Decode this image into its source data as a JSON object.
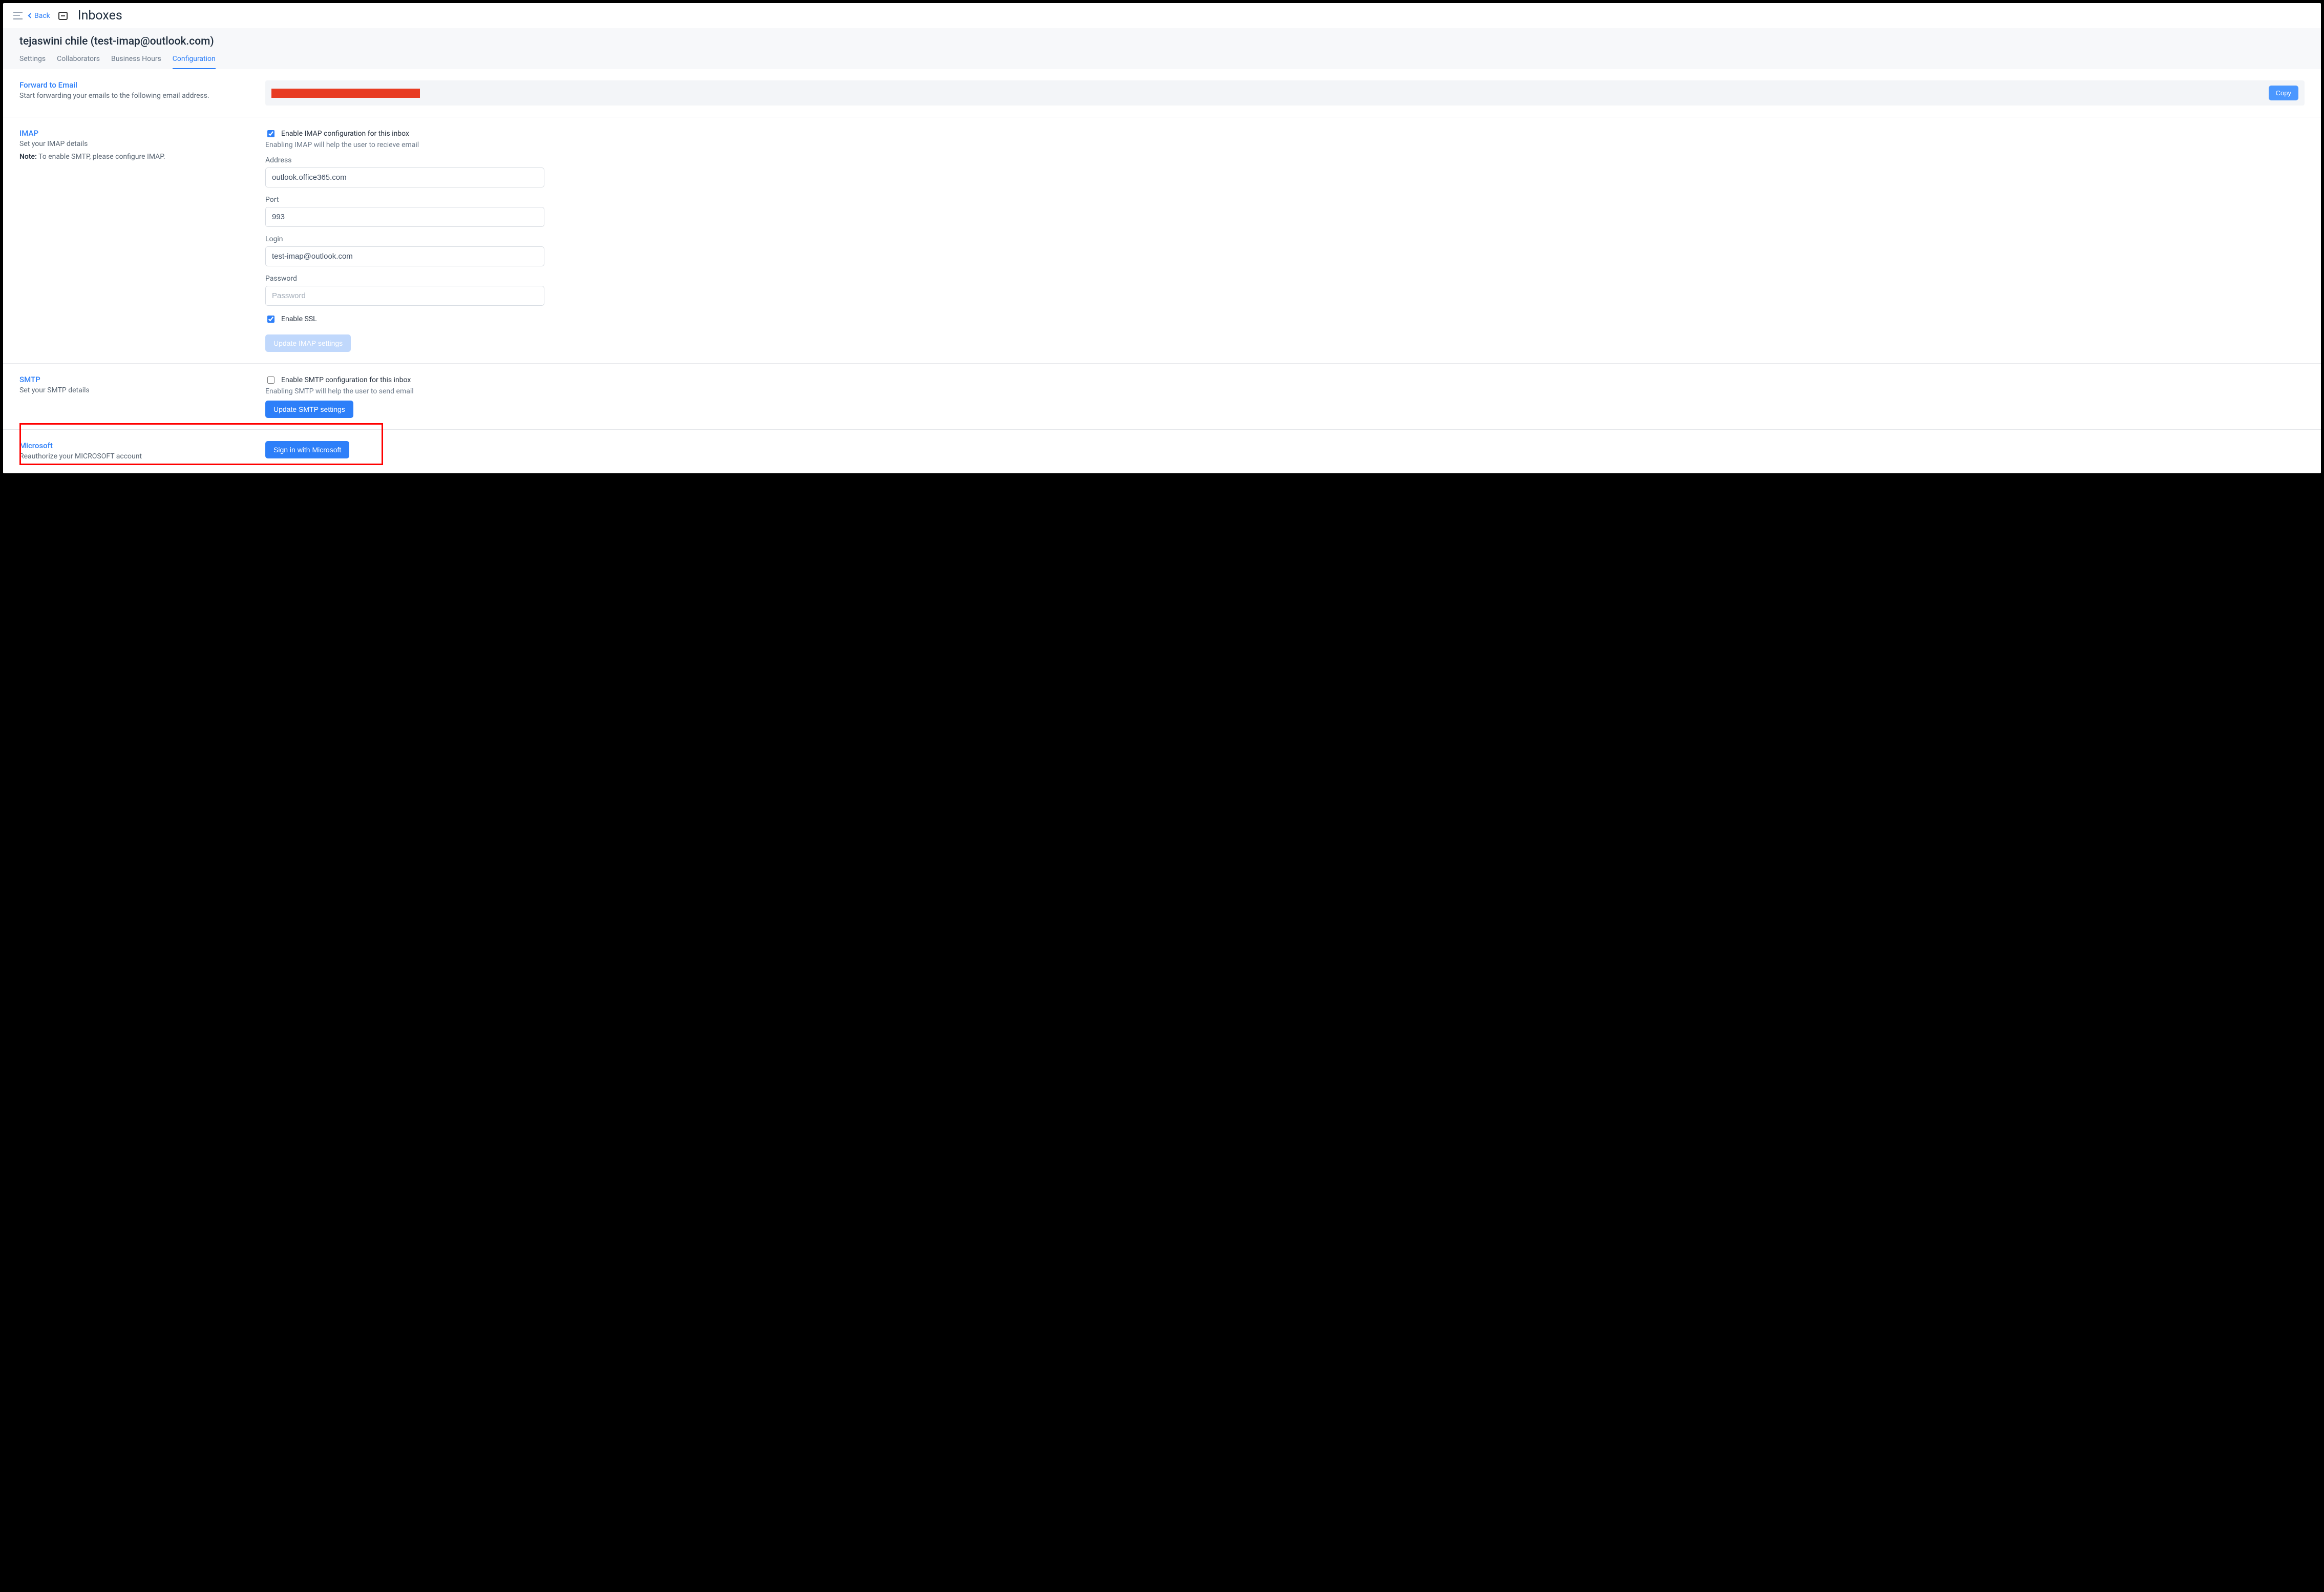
{
  "topbar": {
    "back_label": "Back",
    "page_title": "Inboxes"
  },
  "header": {
    "inbox_name": "tejaswini chile (test-imap@outlook.com)",
    "tabs": {
      "settings": "Settings",
      "collaborators": "Collaborators",
      "business_hours": "Business Hours",
      "configuration": "Configuration"
    }
  },
  "forward": {
    "title": "Forward to Email",
    "desc": "Start forwarding your emails to the following email address.",
    "copy_label": "Copy"
  },
  "imap": {
    "title": "IMAP",
    "desc": "Set your IMAP details",
    "note_label": "Note:",
    "note_text": " To enable SMTP, please configure IMAP.",
    "enable_label": "Enable IMAP configuration for this inbox",
    "enable_hint": "Enabling IMAP will help the user to recieve email",
    "fields": {
      "address_label": "Address",
      "address_value": "outlook.office365.com",
      "port_label": "Port",
      "port_value": "993",
      "login_label": "Login",
      "login_value": "test-imap@outlook.com",
      "password_label": "Password",
      "password_placeholder": "Password"
    },
    "ssl_label": "Enable SSL",
    "update_button": "Update IMAP settings"
  },
  "smtp": {
    "title": "SMTP",
    "desc": "Set your SMTP details",
    "enable_label": "Enable SMTP configuration for this inbox",
    "enable_hint": "Enabling SMTP will help the user to send email",
    "update_button": "Update SMTP settings"
  },
  "microsoft": {
    "title": "Microsoft",
    "desc": "Reauthorize your MICROSOFT account",
    "signin_button": "Sign in with Microsoft"
  }
}
